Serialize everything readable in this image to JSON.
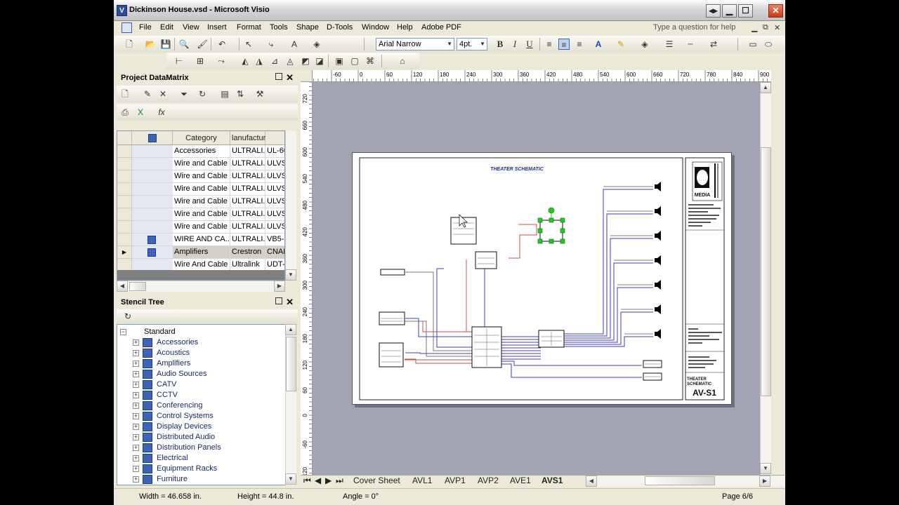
{
  "window": {
    "title": "Dickinson House.vsd - Microsoft Visio"
  },
  "menu": {
    "items": [
      "File",
      "Edit",
      "View",
      "Insert",
      "Format",
      "Tools",
      "Shape",
      "D-Tools",
      "Window",
      "Help",
      "Adobe PDF"
    ],
    "help_placeholder": "Type a question for help"
  },
  "toolbar": {
    "font_name": "Arial Narrow",
    "font_size": "4pt."
  },
  "datamatrix": {
    "title": "Project DataMatrix",
    "columns": [
      "Category",
      "lanufacture"
    ],
    "rows": [
      {
        "category": "Accessories",
        "manufacturer": "ULTRALI...",
        "model": "UL-60"
      },
      {
        "category": "Wire and Cable",
        "manufacturer": "ULTRALI...",
        "model": "ULVS"
      },
      {
        "category": "Wire and Cable",
        "manufacturer": "ULTRALI...",
        "model": "ULVS"
      },
      {
        "category": "Wire and Cable",
        "manufacturer": "ULTRALI...",
        "model": "ULVS"
      },
      {
        "category": "Wire and Cable",
        "manufacturer": "ULTRALI...",
        "model": "ULVS"
      },
      {
        "category": "Wire and Cable",
        "manufacturer": "ULTRALI...",
        "model": "ULVS"
      },
      {
        "category": "Wire and Cable",
        "manufacturer": "ULTRALI...",
        "model": "ULVS"
      },
      {
        "category": "WIRE AND CA...",
        "manufacturer": "ULTRALI...",
        "model": "VB5-2"
      },
      {
        "category": "Amplifiers",
        "manufacturer": "Crestron",
        "model": "CNAM"
      },
      {
        "category": "Wire And Cable",
        "manufacturer": "Ultralink",
        "model": "UDT-"
      }
    ]
  },
  "stencil_tree": {
    "title": "Stencil Tree",
    "root": "Standard",
    "items": [
      "Accessories",
      "Acoustics",
      "Amplifiers",
      "Audio Sources",
      "CATV",
      "CCTV",
      "Conferencing",
      "Control Systems",
      "Display Devices",
      "Distributed Audio",
      "Distribution Panels",
      "Electrical",
      "Equipment Racks",
      "Furniture"
    ]
  },
  "ruler": {
    "h_labels": [
      "-60",
      "0",
      "60",
      "120",
      "180",
      "240",
      "300",
      "360",
      "420",
      "480",
      "540",
      "600",
      "660",
      "720",
      "780",
      "840",
      "900"
    ],
    "v_labels": [
      "720",
      "660",
      "600",
      "540",
      "480",
      "420",
      "360",
      "300",
      "240",
      "180",
      "120",
      "60",
      "0",
      "-60",
      "-120"
    ]
  },
  "drawing": {
    "title": "THEATER SCHEMATIC",
    "title_block_name": "THEATER SCHEMATIC",
    "title_block_id": "AV-S1",
    "logo_text": "MEDIA"
  },
  "tabs": [
    "Cover Sheet",
    "AVL1",
    "AVP1",
    "AVP2",
    "AVE1",
    "AVS1"
  ],
  "status": {
    "width": "Width = 46.658 in.",
    "height": "Height = 44.8 in.",
    "angle": "Angle = 0°",
    "page": "Page 6/6"
  },
  "colors": {
    "wire_blue": "#3b3bd0",
    "wire_red": "#d24b4b",
    "wire_gray": "#777777",
    "selection_green": "#1fcc1f",
    "drawing_title": "#1f2f9a"
  }
}
